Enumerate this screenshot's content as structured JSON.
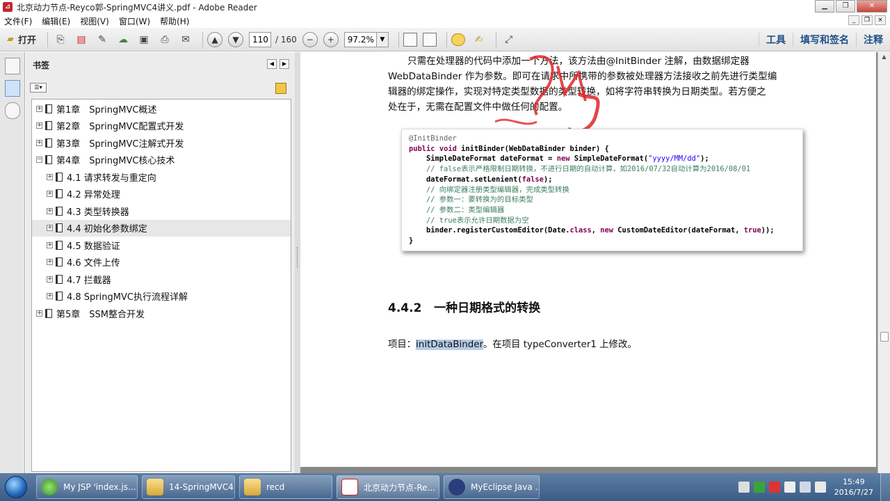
{
  "window": {
    "title": "北京动力节点-Reyco郭-SpringMVC4讲义.pdf - Adobe Reader",
    "app_icon": "adobe-reader-icon"
  },
  "menu": {
    "items": [
      "文件(F)",
      "编辑(E)",
      "视图(V)",
      "窗口(W)",
      "帮助(H)"
    ]
  },
  "toolbar": {
    "open_label": "打开",
    "page_current": "110",
    "page_total": "/ 160",
    "zoom": "97.2%",
    "right_tabs": [
      "工具",
      "填写和签名",
      "注释"
    ]
  },
  "bookmarks": {
    "title": "书签",
    "items": [
      {
        "label": "第1章　SpringMVC概述",
        "level": 0,
        "expander": "+"
      },
      {
        "label": "第2章　SpringMVC配置式开发",
        "level": 0,
        "expander": "+"
      },
      {
        "label": "第3章　SpringMVC注解式开发",
        "level": 0,
        "expander": "+"
      },
      {
        "label": "第4章　SpringMVC核心技术",
        "level": 0,
        "expander": "−"
      },
      {
        "label": "4.1 请求转发与重定向",
        "level": 1,
        "expander": "+"
      },
      {
        "label": "4.2 异常处理",
        "level": 1,
        "expander": "+"
      },
      {
        "label": "4.3 类型转换器",
        "level": 1,
        "expander": "+"
      },
      {
        "label": "4.4 初始化参数绑定",
        "level": 1,
        "expander": "+",
        "selected": true
      },
      {
        "label": "4.5 数据验证",
        "level": 1,
        "expander": "+"
      },
      {
        "label": "4.6 文件上传",
        "level": 1,
        "expander": "+"
      },
      {
        "label": "4.7 拦截器",
        "level": 1,
        "expander": "+"
      },
      {
        "label": "4.8 SpringMVC执行流程详解",
        "level": 1,
        "expander": "+"
      },
      {
        "label": "第5章　SSM整合开发",
        "level": 0,
        "expander": "+"
      }
    ]
  },
  "document": {
    "paragraph_lines": [
      "只需在处理器的代码中添加一个方法，该方法由@InitBinder 注解，由数据绑定器",
      "WebDataBinder 作为参数。即可在请求中所携带的参数被处理器方法接收之前先进行类型编",
      "辑器的绑定操作，实现对特定类型数据的类型转换，如将字符串转换为日期类型。若方便之",
      "处在于，无需在配置文件中做任何的配置。"
    ],
    "code": {
      "annotation": "@InitBinder",
      "sig_kw1": "public",
      "sig_kw2": "void",
      "sig_rest": " initBinder(WebDataBinder binder) {",
      "line3_a": "    SimpleDateFormat dateFormat = ",
      "line3_kw": "new",
      "line3_b": " SimpleDateFormat(",
      "line3_str": "\"yyyy/MM/dd\"",
      "line3_c": ");",
      "comment1": "    // false表示严格限制日期转换，不进行日期的自动计算，如2016/07/32自动计算为2016/08/01",
      "line5_a": "    dateFormat.setLenient(",
      "line5_kw": "false",
      "line5_b": ");",
      "comment2": "    // 向绑定器注册类型编辑器，完成类型转换",
      "comment3": "    // 参数一：要转换为的目标类型",
      "comment4": "    // 参数二：类型编辑器",
      "comment5": "    // true表示允许日期数据为空",
      "line10_a": "    binder.registerCustomEditor(Date.",
      "line10_kw1": "class",
      "line10_b": ", ",
      "line10_kw2": "new",
      "line10_c": " CustomDateEditor(dateFormat, ",
      "line10_kw3": "true",
      "line10_d": "));",
      "closing": "}"
    },
    "section_number": "4.4.2",
    "section_title": "一种日期格式的转换",
    "project_prefix": "项目：",
    "project_name": "initDataBinder",
    "project_suffix": "。在项目 typeConverter1 上修改。"
  },
  "taskbar": {
    "tasks": [
      "My JSP 'index.js...",
      "14-SpringMVC4",
      "recd",
      "北京动力节点-Re...",
      "MyEclipse Java ..."
    ],
    "time": "15:49",
    "date": "2016/7/27"
  },
  "colors": {
    "annotation_stamp": "#e0252a",
    "selection_highlight": "#b5cbe6",
    "toolbar_link": "#1f4f8a"
  }
}
